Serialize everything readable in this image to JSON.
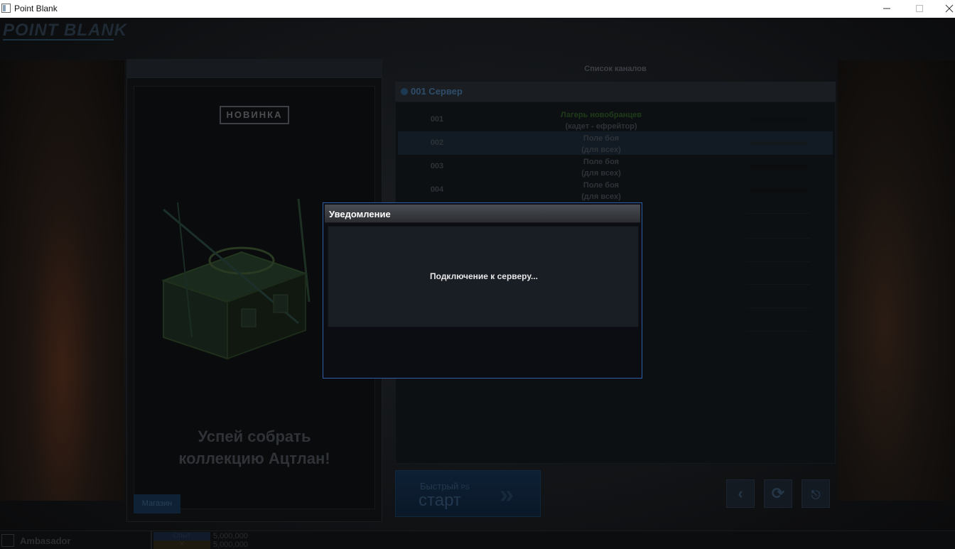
{
  "window": {
    "title": "Point Blank"
  },
  "game": {
    "logo": "POINT BLANK",
    "promo": {
      "badge": "НОВИНКА",
      "text_line1": "Успей собрать",
      "text_line2": "коллекцию Ацтлан!",
      "shop_button": "Магазин"
    },
    "channels": {
      "title": "Список каналов",
      "server": "001 Сервер",
      "rows": [
        {
          "num": "001",
          "line1": "Лагерь новобранцев",
          "line2": "(кадет - ефрейтор)"
        },
        {
          "num": "002",
          "line1": "Поле боя",
          "line2": "(для всех)"
        },
        {
          "num": "003",
          "line1": "Поле боя",
          "line2": "(для всех)"
        },
        {
          "num": "004",
          "line1": "Поле боя",
          "line2": "(для всех)"
        }
      ]
    },
    "quick_start": {
      "small": "Быстрый",
      "small_tag": "PS",
      "big": "старт"
    },
    "status_bar": {
      "player_name": "Ambasador",
      "label1": "Опыт",
      "value1": "5,000,000",
      "value2": "5,000,000"
    }
  },
  "modal": {
    "title": "Уведомление",
    "message": "Подключение к серверу..."
  },
  "colors": {
    "modal_border": "#2f5fa8",
    "modal_header": "#3a3d42",
    "modal_body": "#191d24"
  }
}
